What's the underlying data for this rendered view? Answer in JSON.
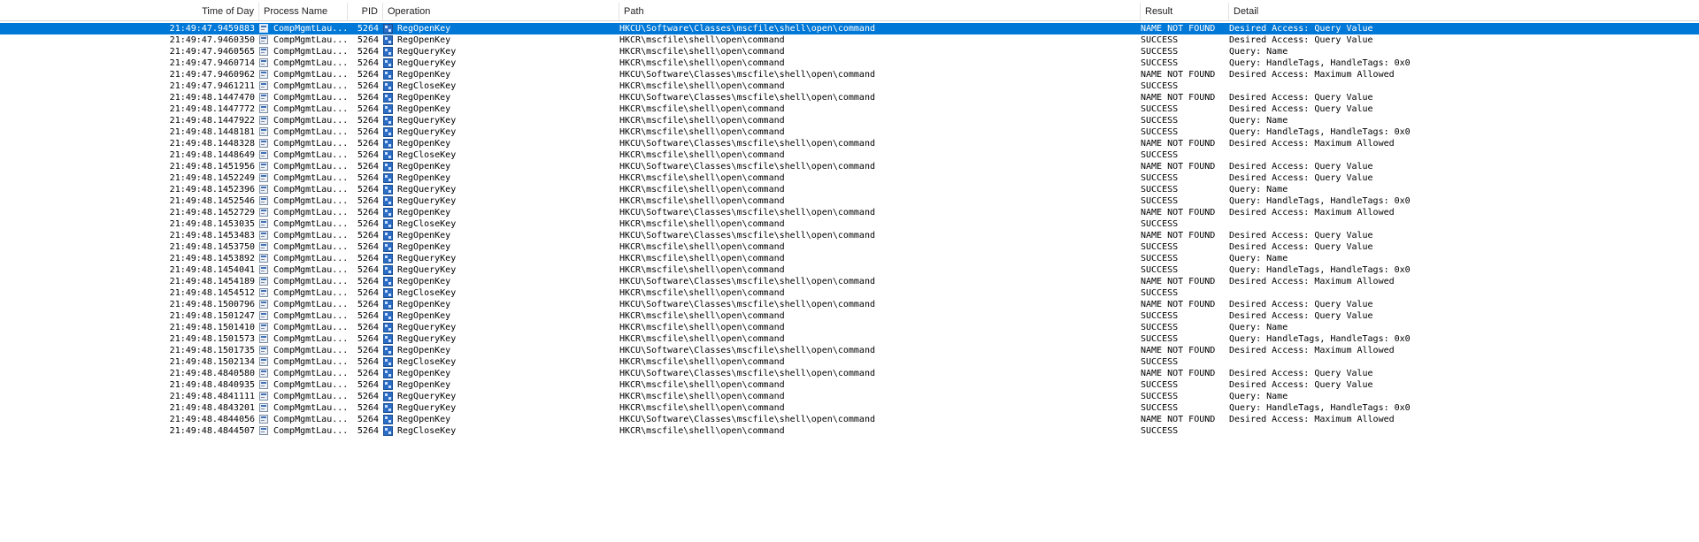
{
  "columns": {
    "time": "Time of Day",
    "process": "Process Name",
    "pid": "PID",
    "operation": "Operation",
    "path": "Path",
    "result": "Result",
    "detail": "Detail"
  },
  "selected_row": 0,
  "rows": [
    {
      "time": "21:49:47.9459883",
      "process": "CompMgmtLau...",
      "pid": "5264",
      "operation": "RegOpenKey",
      "path": "HKCU\\Software\\Classes\\mscfile\\shell\\open\\command",
      "result": "NAME NOT FOUND",
      "detail": "Desired Access: Query Value"
    },
    {
      "time": "21:49:47.9460350",
      "process": "CompMgmtLau...",
      "pid": "5264",
      "operation": "RegOpenKey",
      "path": "HKCR\\mscfile\\shell\\open\\command",
      "result": "SUCCESS",
      "detail": "Desired Access: Query Value"
    },
    {
      "time": "21:49:47.9460565",
      "process": "CompMgmtLau...",
      "pid": "5264",
      "operation": "RegQueryKey",
      "path": "HKCR\\mscfile\\shell\\open\\command",
      "result": "SUCCESS",
      "detail": "Query: Name"
    },
    {
      "time": "21:49:47.9460714",
      "process": "CompMgmtLau...",
      "pid": "5264",
      "operation": "RegQueryKey",
      "path": "HKCR\\mscfile\\shell\\open\\command",
      "result": "SUCCESS",
      "detail": "Query: HandleTags, HandleTags: 0x0"
    },
    {
      "time": "21:49:47.9460962",
      "process": "CompMgmtLau...",
      "pid": "5264",
      "operation": "RegOpenKey",
      "path": "HKCU\\Software\\Classes\\mscfile\\shell\\open\\command",
      "result": "NAME NOT FOUND",
      "detail": "Desired Access: Maximum Allowed"
    },
    {
      "time": "21:49:47.9461211",
      "process": "CompMgmtLau...",
      "pid": "5264",
      "operation": "RegCloseKey",
      "path": "HKCR\\mscfile\\shell\\open\\command",
      "result": "SUCCESS",
      "detail": ""
    },
    {
      "time": "21:49:48.1447470",
      "process": "CompMgmtLau...",
      "pid": "5264",
      "operation": "RegOpenKey",
      "path": "HKCU\\Software\\Classes\\mscfile\\shell\\open\\command",
      "result": "NAME NOT FOUND",
      "detail": "Desired Access: Query Value"
    },
    {
      "time": "21:49:48.1447772",
      "process": "CompMgmtLau...",
      "pid": "5264",
      "operation": "RegOpenKey",
      "path": "HKCR\\mscfile\\shell\\open\\command",
      "result": "SUCCESS",
      "detail": "Desired Access: Query Value"
    },
    {
      "time": "21:49:48.1447922",
      "process": "CompMgmtLau...",
      "pid": "5264",
      "operation": "RegQueryKey",
      "path": "HKCR\\mscfile\\shell\\open\\command",
      "result": "SUCCESS",
      "detail": "Query: Name"
    },
    {
      "time": "21:49:48.1448181",
      "process": "CompMgmtLau...",
      "pid": "5264",
      "operation": "RegQueryKey",
      "path": "HKCR\\mscfile\\shell\\open\\command",
      "result": "SUCCESS",
      "detail": "Query: HandleTags, HandleTags: 0x0"
    },
    {
      "time": "21:49:48.1448328",
      "process": "CompMgmtLau...",
      "pid": "5264",
      "operation": "RegOpenKey",
      "path": "HKCU\\Software\\Classes\\mscfile\\shell\\open\\command",
      "result": "NAME NOT FOUND",
      "detail": "Desired Access: Maximum Allowed"
    },
    {
      "time": "21:49:48.1448649",
      "process": "CompMgmtLau...",
      "pid": "5264",
      "operation": "RegCloseKey",
      "path": "HKCR\\mscfile\\shell\\open\\command",
      "result": "SUCCESS",
      "detail": ""
    },
    {
      "time": "21:49:48.1451956",
      "process": "CompMgmtLau...",
      "pid": "5264",
      "operation": "RegOpenKey",
      "path": "HKCU\\Software\\Classes\\mscfile\\shell\\open\\command",
      "result": "NAME NOT FOUND",
      "detail": "Desired Access: Query Value"
    },
    {
      "time": "21:49:48.1452249",
      "process": "CompMgmtLau...",
      "pid": "5264",
      "operation": "RegOpenKey",
      "path": "HKCR\\mscfile\\shell\\open\\command",
      "result": "SUCCESS",
      "detail": "Desired Access: Query Value"
    },
    {
      "time": "21:49:48.1452396",
      "process": "CompMgmtLau...",
      "pid": "5264",
      "operation": "RegQueryKey",
      "path": "HKCR\\mscfile\\shell\\open\\command",
      "result": "SUCCESS",
      "detail": "Query: Name"
    },
    {
      "time": "21:49:48.1452546",
      "process": "CompMgmtLau...",
      "pid": "5264",
      "operation": "RegQueryKey",
      "path": "HKCR\\mscfile\\shell\\open\\command",
      "result": "SUCCESS",
      "detail": "Query: HandleTags, HandleTags: 0x0"
    },
    {
      "time": "21:49:48.1452729",
      "process": "CompMgmtLau...",
      "pid": "5264",
      "operation": "RegOpenKey",
      "path": "HKCU\\Software\\Classes\\mscfile\\shell\\open\\command",
      "result": "NAME NOT FOUND",
      "detail": "Desired Access: Maximum Allowed"
    },
    {
      "time": "21:49:48.1453035",
      "process": "CompMgmtLau...",
      "pid": "5264",
      "operation": "RegCloseKey",
      "path": "HKCR\\mscfile\\shell\\open\\command",
      "result": "SUCCESS",
      "detail": ""
    },
    {
      "time": "21:49:48.1453483",
      "process": "CompMgmtLau...",
      "pid": "5264",
      "operation": "RegOpenKey",
      "path": "HKCU\\Software\\Classes\\mscfile\\shell\\open\\command",
      "result": "NAME NOT FOUND",
      "detail": "Desired Access: Query Value"
    },
    {
      "time": "21:49:48.1453750",
      "process": "CompMgmtLau...",
      "pid": "5264",
      "operation": "RegOpenKey",
      "path": "HKCR\\mscfile\\shell\\open\\command",
      "result": "SUCCESS",
      "detail": "Desired Access: Query Value"
    },
    {
      "time": "21:49:48.1453892",
      "process": "CompMgmtLau...",
      "pid": "5264",
      "operation": "RegQueryKey",
      "path": "HKCR\\mscfile\\shell\\open\\command",
      "result": "SUCCESS",
      "detail": "Query: Name"
    },
    {
      "time": "21:49:48.1454041",
      "process": "CompMgmtLau...",
      "pid": "5264",
      "operation": "RegQueryKey",
      "path": "HKCR\\mscfile\\shell\\open\\command",
      "result": "SUCCESS",
      "detail": "Query: HandleTags, HandleTags: 0x0"
    },
    {
      "time": "21:49:48.1454189",
      "process": "CompMgmtLau...",
      "pid": "5264",
      "operation": "RegOpenKey",
      "path": "HKCU\\Software\\Classes\\mscfile\\shell\\open\\command",
      "result": "NAME NOT FOUND",
      "detail": "Desired Access: Maximum Allowed"
    },
    {
      "time": "21:49:48.1454512",
      "process": "CompMgmtLau...",
      "pid": "5264",
      "operation": "RegCloseKey",
      "path": "HKCR\\mscfile\\shell\\open\\command",
      "result": "SUCCESS",
      "detail": ""
    },
    {
      "time": "21:49:48.1500796",
      "process": "CompMgmtLau...",
      "pid": "5264",
      "operation": "RegOpenKey",
      "path": "HKCU\\Software\\Classes\\mscfile\\shell\\open\\command",
      "result": "NAME NOT FOUND",
      "detail": "Desired Access: Query Value"
    },
    {
      "time": "21:49:48.1501247",
      "process": "CompMgmtLau...",
      "pid": "5264",
      "operation": "RegOpenKey",
      "path": "HKCR\\mscfile\\shell\\open\\command",
      "result": "SUCCESS",
      "detail": "Desired Access: Query Value"
    },
    {
      "time": "21:49:48.1501410",
      "process": "CompMgmtLau...",
      "pid": "5264",
      "operation": "RegQueryKey",
      "path": "HKCR\\mscfile\\shell\\open\\command",
      "result": "SUCCESS",
      "detail": "Query: Name"
    },
    {
      "time": "21:49:48.1501573",
      "process": "CompMgmtLau...",
      "pid": "5264",
      "operation": "RegQueryKey",
      "path": "HKCR\\mscfile\\shell\\open\\command",
      "result": "SUCCESS",
      "detail": "Query: HandleTags, HandleTags: 0x0"
    },
    {
      "time": "21:49:48.1501735",
      "process": "CompMgmtLau...",
      "pid": "5264",
      "operation": "RegOpenKey",
      "path": "HKCU\\Software\\Classes\\mscfile\\shell\\open\\command",
      "result": "NAME NOT FOUND",
      "detail": "Desired Access: Maximum Allowed"
    },
    {
      "time": "21:49:48.1502134",
      "process": "CompMgmtLau...",
      "pid": "5264",
      "operation": "RegCloseKey",
      "path": "HKCR\\mscfile\\shell\\open\\command",
      "result": "SUCCESS",
      "detail": ""
    },
    {
      "time": "21:49:48.4840580",
      "process": "CompMgmtLau...",
      "pid": "5264",
      "operation": "RegOpenKey",
      "path": "HKCU\\Software\\Classes\\mscfile\\shell\\open\\command",
      "result": "NAME NOT FOUND",
      "detail": "Desired Access: Query Value"
    },
    {
      "time": "21:49:48.4840935",
      "process": "CompMgmtLau...",
      "pid": "5264",
      "operation": "RegOpenKey",
      "path": "HKCR\\mscfile\\shell\\open\\command",
      "result": "SUCCESS",
      "detail": "Desired Access: Query Value"
    },
    {
      "time": "21:49:48.4841111",
      "process": "CompMgmtLau...",
      "pid": "5264",
      "operation": "RegQueryKey",
      "path": "HKCR\\mscfile\\shell\\open\\command",
      "result": "SUCCESS",
      "detail": "Query: Name"
    },
    {
      "time": "21:49:48.4843201",
      "process": "CompMgmtLau...",
      "pid": "5264",
      "operation": "RegQueryKey",
      "path": "HKCR\\mscfile\\shell\\open\\command",
      "result": "SUCCESS",
      "detail": "Query: HandleTags, HandleTags: 0x0"
    },
    {
      "time": "21:49:48.4844056",
      "process": "CompMgmtLau...",
      "pid": "5264",
      "operation": "RegOpenKey",
      "path": "HKCU\\Software\\Classes\\mscfile\\shell\\open\\command",
      "result": "NAME NOT FOUND",
      "detail": "Desired Access: Maximum Allowed"
    },
    {
      "time": "21:49:48.4844507",
      "process": "CompMgmtLau...",
      "pid": "5264",
      "operation": "RegCloseKey",
      "path": "HKCR\\mscfile\\shell\\open\\command",
      "result": "SUCCESS",
      "detail": ""
    }
  ]
}
